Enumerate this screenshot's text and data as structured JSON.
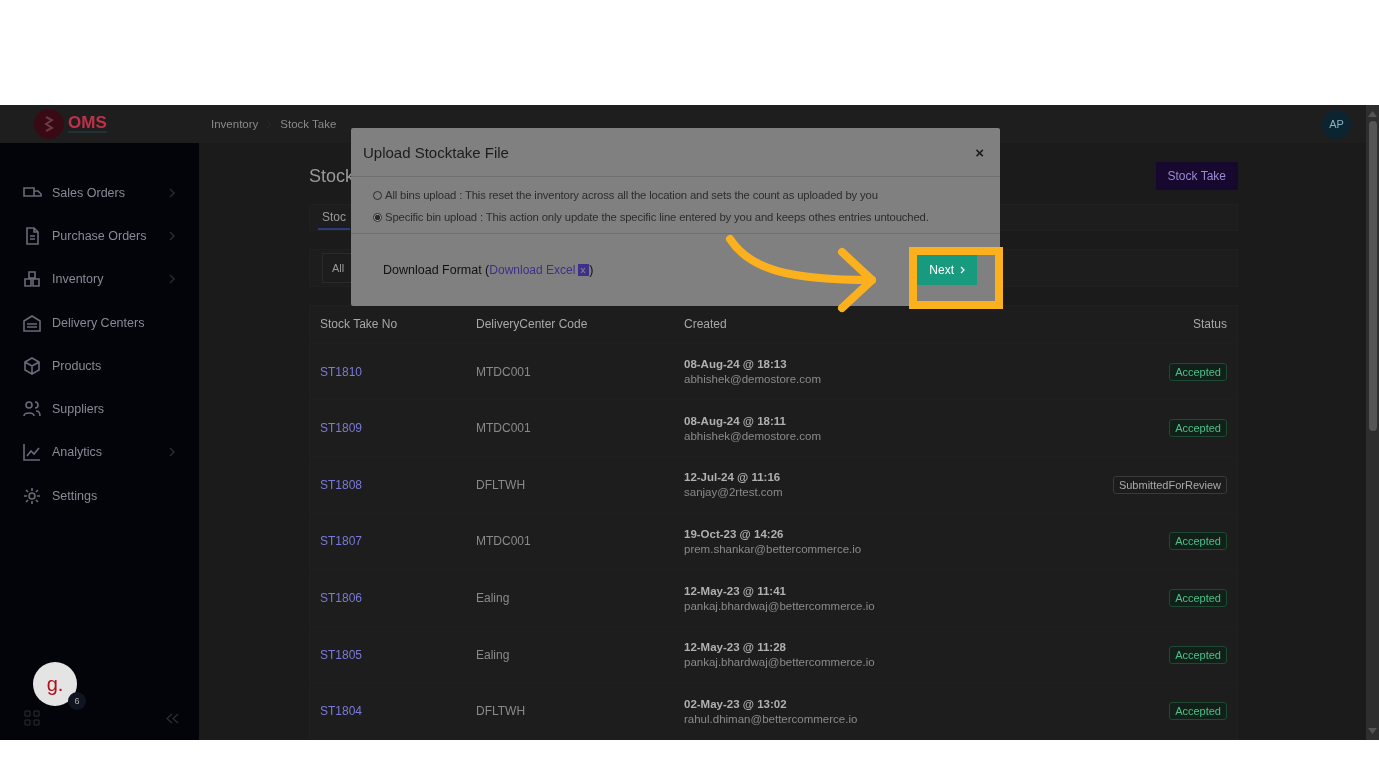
{
  "header": {
    "logo_text": "OMS",
    "breadcrumb": [
      "Inventory",
      "Stock Take"
    ],
    "avatar": "AP"
  },
  "sidebar": {
    "items": [
      {
        "label": "Sales Orders",
        "has_submenu": true
      },
      {
        "label": "Purchase Orders",
        "has_submenu": true
      },
      {
        "label": "Inventory",
        "has_submenu": true
      },
      {
        "label": "Delivery Centers",
        "has_submenu": false
      },
      {
        "label": "Products",
        "has_submenu": false
      },
      {
        "label": "Suppliers",
        "has_submenu": false
      },
      {
        "label": "Analytics",
        "has_submenu": true
      },
      {
        "label": "Settings",
        "has_submenu": false
      }
    ],
    "chat_logo": "g.",
    "chat_badge": "6"
  },
  "page": {
    "title": "Stock",
    "action_button": "Stock Take",
    "tabs": [
      {
        "label": "Stoc",
        "selected": true
      }
    ],
    "filter": "All"
  },
  "table": {
    "columns": [
      "Stock Take No",
      "DeliveryCenter Code",
      "Created",
      "Status"
    ],
    "rows": [
      {
        "number": "ST1810",
        "center": "MTDC001",
        "date": "08-Aug-24 @ 18:13",
        "user": "abhishek@demostore.com",
        "status": "Accepted",
        "kind": "accepted"
      },
      {
        "number": "ST1809",
        "center": "MTDC001",
        "date": "08-Aug-24 @ 18:11",
        "user": "abhishek@demostore.com",
        "status": "Accepted",
        "kind": "accepted"
      },
      {
        "number": "ST1808",
        "center": "DFLTWH",
        "date": "12-Jul-24 @ 11:16",
        "user": "sanjay@2rtest.com",
        "status": "SubmittedForReview",
        "kind": "review"
      },
      {
        "number": "ST1807",
        "center": "MTDC001",
        "date": "19-Oct-23 @ 14:26",
        "user": "prem.shankar@bettercommerce.io",
        "status": "Accepted",
        "kind": "accepted"
      },
      {
        "number": "ST1806",
        "center": "Ealing",
        "date": "12-May-23 @ 11:41",
        "user": "pankaj.bhardwaj@bettercommerce.io",
        "status": "Accepted",
        "kind": "accepted"
      },
      {
        "number": "ST1805",
        "center": "Ealing",
        "date": "12-May-23 @ 11:28",
        "user": "pankaj.bhardwaj@bettercommerce.io",
        "status": "Accepted",
        "kind": "accepted"
      },
      {
        "number": "ST1804",
        "center": "DFLTWH",
        "date": "02-May-23 @ 13:02",
        "user": "rahul.dhiman@bettercommerce.io",
        "status": "Accepted",
        "kind": "accepted"
      }
    ]
  },
  "modal": {
    "title": "Upload Stocktake File",
    "close": "×",
    "options": [
      {
        "label": "All bins upload : This reset the inventory across all the location and sets the count as uploaded by you",
        "selected": false
      },
      {
        "label": "Specific bin upload : This action only update the specific line entered by you and keeps othes entries untouched.",
        "selected": true
      }
    ],
    "download_label": "Download Format (",
    "download_link": "Download Excel",
    "download_close": ")",
    "next_button": "Next"
  }
}
